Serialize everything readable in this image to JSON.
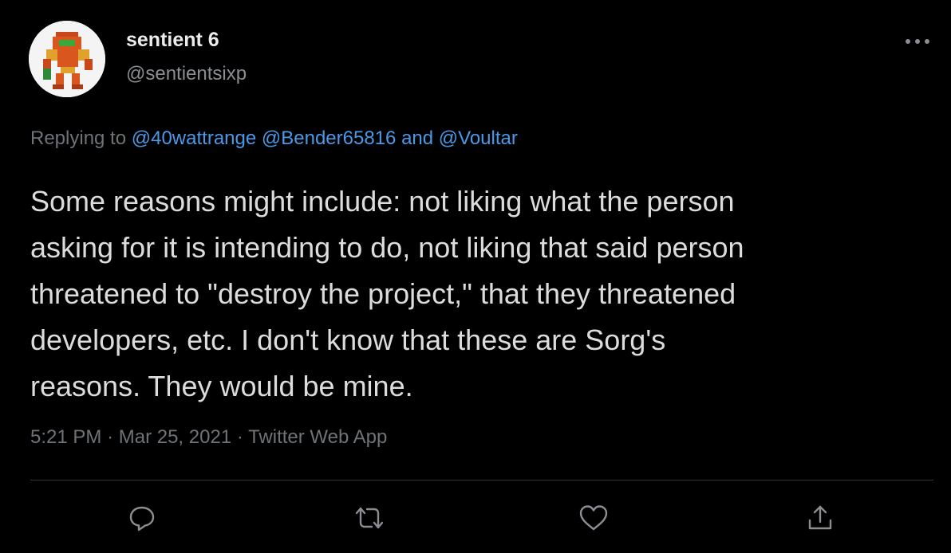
{
  "tweet": {
    "display_name": "sentient 6",
    "handle": "@sentientsixp",
    "replying_prefix": "Replying to",
    "mention_1": "@40wattrange",
    "mention_2": "@Bender65816",
    "mention_joiner": "and",
    "mention_3": "@Voultar",
    "body_lines": [
      "Some reasons might include: not liking what the person",
      "asking for it is intending to do, not liking that said person",
      "threatened to \"destroy the project,\" that they threatened",
      "developers, etc. I don't know that these are Sorg's",
      "reasons. They would be mine."
    ],
    "time": "5:21 PM",
    "separator": "·",
    "date": "Mar 25, 2021",
    "client": "Twitter Web App"
  },
  "icons": {
    "more": "more-horizontal-icon",
    "reply": "reply-icon",
    "retweet": "retweet-icon",
    "like": "like-icon",
    "share": "share-icon"
  },
  "colors": {
    "background": "#000000",
    "text": "#dcdcdc",
    "muted": "#6e7378",
    "link": "#4a99e9",
    "icon": "#8a8d91",
    "divider": "#2f3336"
  }
}
